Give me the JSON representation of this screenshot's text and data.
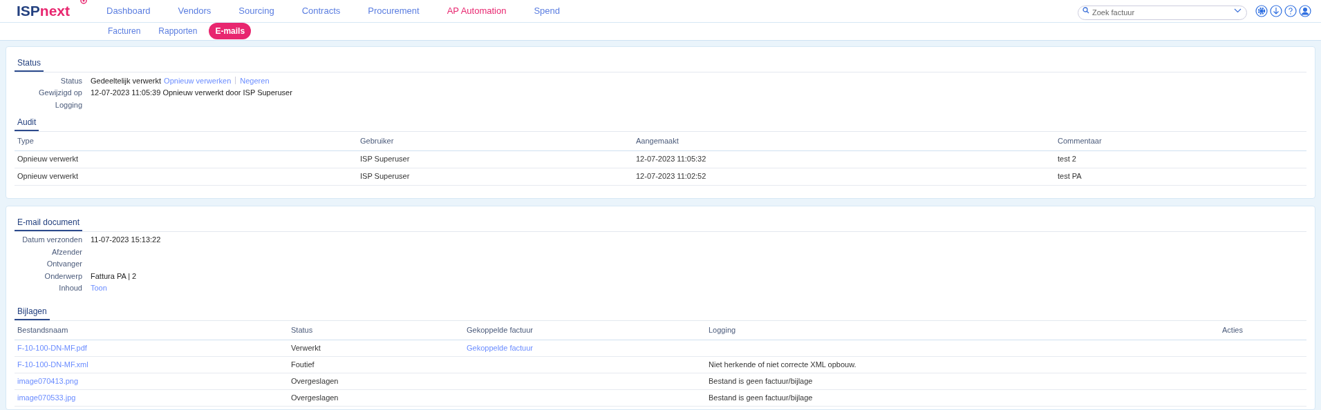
{
  "logo": {
    "part1": "ISP",
    "part2": "next"
  },
  "nav": [
    {
      "label": "Dashboard",
      "selected": false
    },
    {
      "label": "Vendors",
      "selected": false
    },
    {
      "label": "Sourcing",
      "selected": false
    },
    {
      "label": "Contracts",
      "selected": false
    },
    {
      "label": "Procurement",
      "selected": false
    },
    {
      "label": "AP Automation",
      "selected": true
    },
    {
      "label": "Spend",
      "selected": false
    }
  ],
  "search": {
    "placeholder": "Zoek factuur"
  },
  "subnav": [
    {
      "label": "Facturen",
      "selected": false
    },
    {
      "label": "Rapporten",
      "selected": false
    },
    {
      "label": "E-mails",
      "selected": true
    }
  ],
  "status_section": {
    "title": "Status",
    "fields": [
      {
        "label": "Status",
        "value": "Gedeeltelijk verwerkt",
        "links": [
          "Opnieuw verwerken",
          "Negeren"
        ]
      },
      {
        "label": "Gewijzigd op",
        "value": "12-07-2023 11:05:39 Opnieuw verwerkt door ISP Superuser"
      },
      {
        "label": "Logging"
      }
    ]
  },
  "audit": {
    "title": "Audit",
    "columns": [
      "Type",
      "Gebruiker",
      "Aangemaakt",
      "Commentaar"
    ],
    "rows": [
      [
        "Opnieuw verwerkt",
        "ISP Superuser",
        "12-07-2023 11:05:32",
        "test 2"
      ],
      [
        "Opnieuw verwerkt",
        "ISP Superuser",
        "12-07-2023 11:02:52",
        "test PA"
      ]
    ]
  },
  "email_section": {
    "title": "E-mail document",
    "fields": [
      {
        "label": "Datum verzonden",
        "value": "11-07-2023 15:13:22"
      },
      {
        "label": "Afzender"
      },
      {
        "label": "Ontvanger"
      },
      {
        "label": "Onderwerp",
        "value": "Fattura PA | 2"
      },
      {
        "label": "Inhoud",
        "link": "Toon"
      }
    ]
  },
  "attachments": {
    "title": "Bijlagen",
    "columns": [
      "Bestandsnaam",
      "Status",
      "Gekoppelde factuur",
      "Logging",
      "Acties"
    ],
    "rows": [
      {
        "file": "F-10-100-DN-MF.pdf",
        "status": "Verwerkt",
        "invoice": "Gekoppelde factuur"
      },
      {
        "file": "F-10-100-DN-MF.xml",
        "status": "Foutief",
        "logging": "Niet herkende of niet correcte XML opbouw."
      },
      {
        "file": "image070413.png",
        "status": "Overgeslagen",
        "logging": "Bestand is geen factuur/bijlage"
      },
      {
        "file": "image070533.jpg",
        "status": "Overgeslagen",
        "logging": "Bestand is geen factuur/bijlage"
      }
    ]
  }
}
